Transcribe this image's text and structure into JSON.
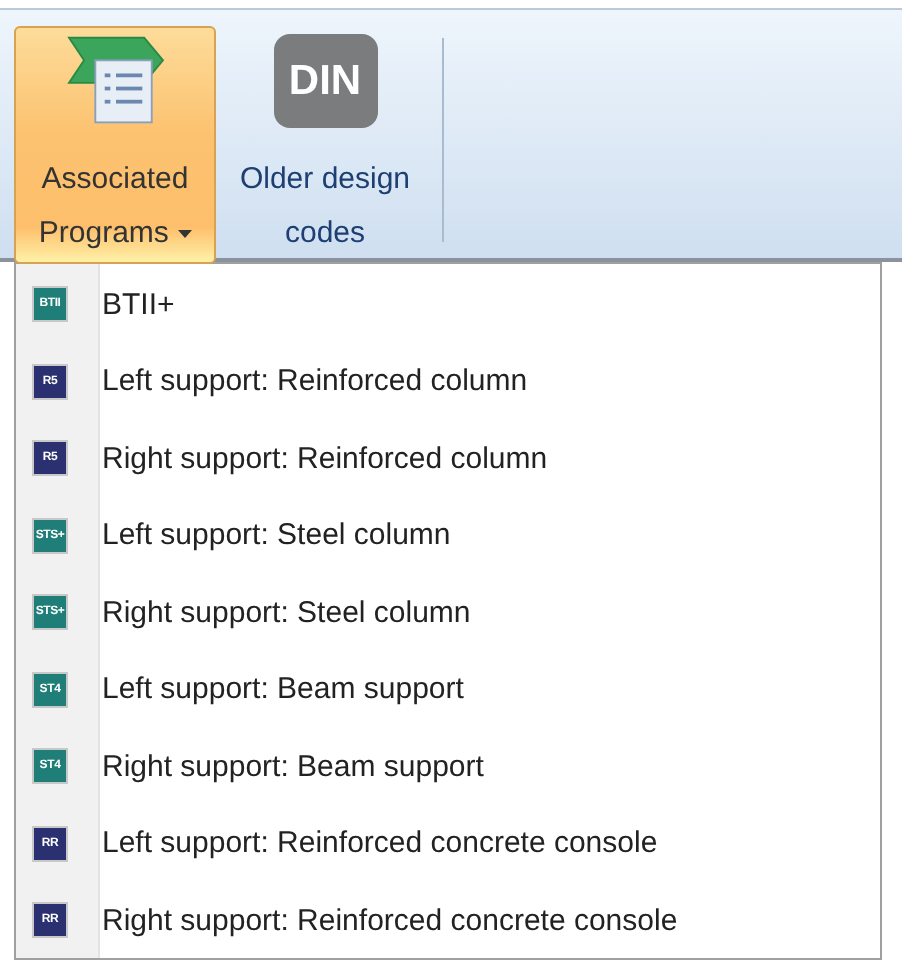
{
  "ribbon": {
    "buttons": [
      {
        "kind": "dropdown",
        "label_lines": [
          "Associated",
          "Programs"
        ],
        "selected": true
      },
      {
        "kind": "din",
        "icon_text": "DIN",
        "label_lines": [
          "Older design",
          "codes"
        ],
        "selected": false
      }
    ]
  },
  "menu": {
    "items": [
      {
        "badge": "BTII",
        "color": "#1f7f78",
        "label": "BTII+"
      },
      {
        "badge": "R5",
        "color": "#2b3170",
        "label": "Left support: Reinforced column"
      },
      {
        "badge": "R5",
        "color": "#2b3170",
        "label": "Right support: Reinforced column"
      },
      {
        "badge": "STS+",
        "color": "#1f7f78",
        "label": "Left support: Steel column"
      },
      {
        "badge": "STS+",
        "color": "#1f7f78",
        "label": "Right support: Steel column"
      },
      {
        "badge": "ST4",
        "color": "#1f7f78",
        "label": "Left support: Beam support"
      },
      {
        "badge": "ST4",
        "color": "#1f7f78",
        "label": "Right support: Beam support"
      },
      {
        "badge": "RR",
        "color": "#2b3170",
        "label": "Left support: Reinforced concrete console"
      },
      {
        "badge": "RR",
        "color": "#2b3170",
        "label": "Right support: Reinforced concrete console"
      }
    ]
  }
}
